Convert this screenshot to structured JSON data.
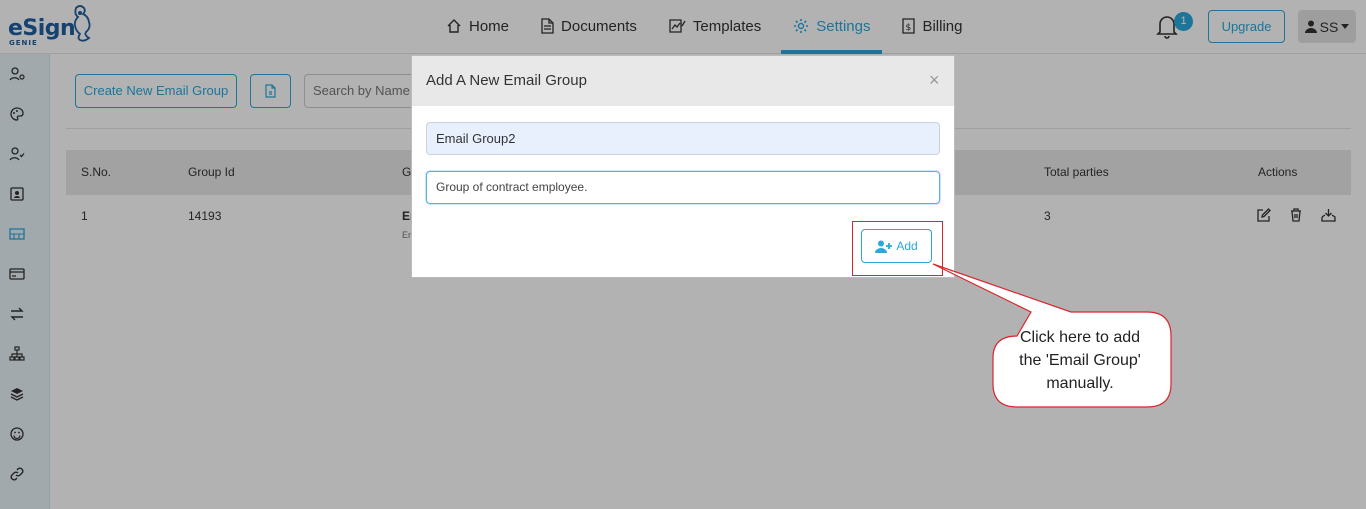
{
  "brand": {
    "name": "eSign",
    "sub": "GENIE",
    "color": "#1f5fa0"
  },
  "nav": {
    "items": [
      {
        "label": "Home",
        "icon": "home-icon"
      },
      {
        "label": "Documents",
        "icon": "document-icon"
      },
      {
        "label": "Templates",
        "icon": "templates-icon"
      },
      {
        "label": "Settings",
        "icon": "gear-icon",
        "active": true
      },
      {
        "label": "Billing",
        "icon": "billing-icon"
      }
    ],
    "accent": "#2aa8dc"
  },
  "header": {
    "notifications_count": "1",
    "upgrade_label": "Upgrade",
    "user_initials": "SS"
  },
  "sidebar": {
    "icons": [
      "user-settings-icon",
      "palette-icon",
      "user-check-icon",
      "contact-card-icon",
      "email-group-icon",
      "card-icon",
      "transfer-icon",
      "sitemap-icon",
      "layers-icon",
      "smiley-icon",
      "link-icon"
    ]
  },
  "toolbar": {
    "create_label": "Create New Email Group",
    "search_placeholder": "Search by Name"
  },
  "table": {
    "headers": {
      "sno": "S.No.",
      "group_id": "Group Id",
      "group_name": "G",
      "total_parties": "Total parties",
      "actions": "Actions"
    },
    "rows": [
      {
        "sno": "1",
        "group_id": "14193",
        "group_name": "Er",
        "group_desc": "Er",
        "total_parties": "3"
      }
    ]
  },
  "modal": {
    "title": "Add A New Email Group",
    "close": "×",
    "group_name_value": "Email Group2",
    "group_desc_value": "Group of contract employee.",
    "add_label": "Add"
  },
  "callout": {
    "line1": "Click here to add",
    "line2": "the 'Email Group'",
    "line3": "manually."
  }
}
